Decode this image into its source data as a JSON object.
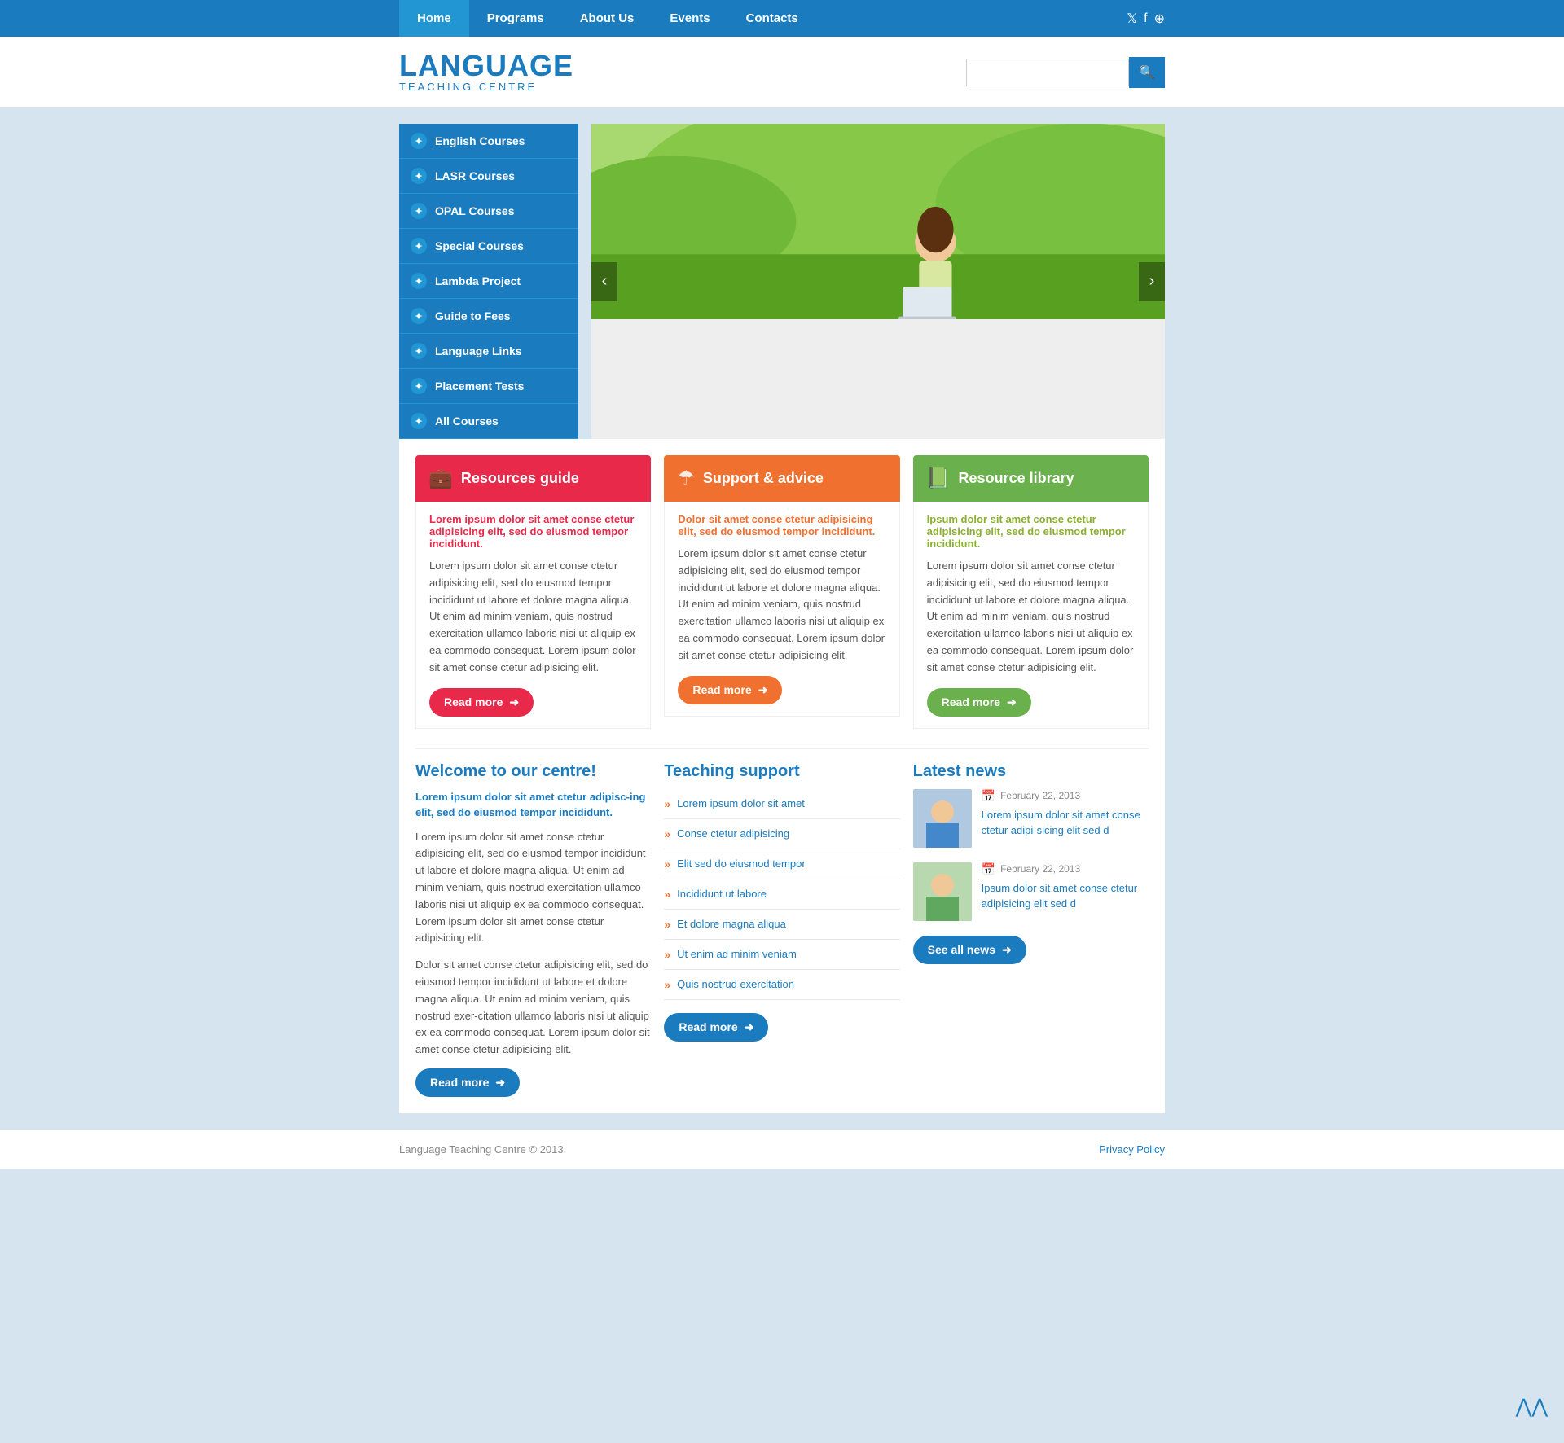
{
  "nav": {
    "links": [
      {
        "label": "Home",
        "active": true
      },
      {
        "label": "Programs",
        "active": false
      },
      {
        "label": "About Us",
        "active": false
      },
      {
        "label": "Events",
        "active": false
      },
      {
        "label": "Contacts",
        "active": false
      }
    ],
    "icons": [
      "twitter",
      "facebook",
      "rss"
    ]
  },
  "header": {
    "logo_main": "LANGUAGE",
    "logo_sub": "TEACHING CENTRE",
    "search_placeholder": ""
  },
  "sidebar": {
    "items": [
      {
        "label": "English Courses"
      },
      {
        "label": "LASR Courses"
      },
      {
        "label": "OPAL Courses"
      },
      {
        "label": "Special Courses"
      },
      {
        "label": "Lambda Project"
      },
      {
        "label": "Guide to Fees"
      },
      {
        "label": "Language Links"
      },
      {
        "label": "Placement Tests"
      },
      {
        "label": "All Courses"
      }
    ]
  },
  "slider": {
    "prev_label": "‹",
    "next_label": "›"
  },
  "features": [
    {
      "id": "resources",
      "color": "red",
      "icon": "💼",
      "title": "Resources guide",
      "highlight": "Lorem ipsum dolor sit amet conse ctetur adipisicing elit, sed do eiusmod tempor incididunt.",
      "text": "Lorem ipsum dolor sit amet conse ctetur adipisicing elit, sed do eiusmod tempor incididunt ut labore et dolore magna aliqua. Ut enim ad minim veniam, quis nostrud exercitation ullamco laboris nisi ut aliquip ex ea commodo consequat. Lorem ipsum dolor sit amet conse ctetur adipisicing elit.",
      "btn_label": "Read more"
    },
    {
      "id": "support",
      "color": "orange",
      "icon": "☂",
      "title": "Support & advice",
      "highlight": "Dolor sit amet conse ctetur adipisicing elit, sed do eiusmod tempor incididunt.",
      "text": "Lorem ipsum dolor sit amet conse ctetur adipisicing elit, sed do eiusmod tempor incididunt ut labore et dolore magna aliqua. Ut enim ad minim veniam, quis nostrud exercitation ullamco laboris nisi ut aliquip ex ea commodo consequat. Lorem ipsum dolor sit amet conse ctetur adipisicing elit.",
      "btn_label": "Read more"
    },
    {
      "id": "library",
      "color": "green",
      "icon": "📗",
      "title": "Resource library",
      "highlight": "Ipsum dolor sit amet conse ctetur adipisicing elit, sed do eiusmod tempor incididunt.",
      "text": "Lorem ipsum dolor sit amet conse ctetur adipisicing elit, sed do eiusmod tempor incididunt ut labore et dolore magna aliqua. Ut enim ad minim veniam, quis nostrud exercitation ullamco laboris nisi ut aliquip ex ea commodo consequat. Lorem ipsum dolor sit amet conse ctetur adipisicing elit.",
      "btn_label": "Read more"
    }
  ],
  "welcome": {
    "title": "Welcome to our centre!",
    "highlight": "Lorem ipsum dolor sit amet ctetur adipisc-ing elit, sed do eiusmod tempor incididunt.",
    "text1": "Lorem ipsum dolor sit amet conse ctetur adipisicing elit, sed do eiusmod tempor incididunt ut labore et dolore magna aliqua. Ut enim ad minim veniam, quis nostrud exercitation ullamco laboris nisi ut aliquip ex ea commodo consequat. Lorem ipsum dolor sit amet conse ctetur adipisicing elit.",
    "text2": "Dolor sit amet conse ctetur adipisicing elit, sed do eiusmod tempor incididunt ut labore et dolore magna aliqua. Ut enim ad minim veniam, quis nostrud exer-citation ullamco laboris nisi ut aliquip ex ea commodo consequat. Lorem ipsum dolor sit amet conse ctetur adipisicing elit.",
    "btn_label": "Read more"
  },
  "teaching_support": {
    "title": "Teaching support",
    "items": [
      "Lorem ipsum dolor sit amet",
      "Conse ctetur adipisicing",
      "Elit sed do eiusmod tempor",
      "Incididunt ut labore",
      "Et dolore magna aliqua",
      "Ut enim ad minim veniam",
      "Quis nostrud exercitation"
    ],
    "btn_label": "Read more"
  },
  "latest_news": {
    "title": "Latest news",
    "news": [
      {
        "date": "February 22, 2013",
        "title": "Lorem ipsum dolor sit amet conse ctetur adipi-sicing elit sed d"
      },
      {
        "date": "February 22, 2013",
        "title": "Ipsum dolor sit amet conse ctetur adipisicing elit sed d"
      }
    ],
    "btn_label": "See all news"
  },
  "footer": {
    "copyright": "Language Teaching Centre © 2013.",
    "privacy_label": "Privacy Policy"
  },
  "back_to_top": "⋀⋀"
}
